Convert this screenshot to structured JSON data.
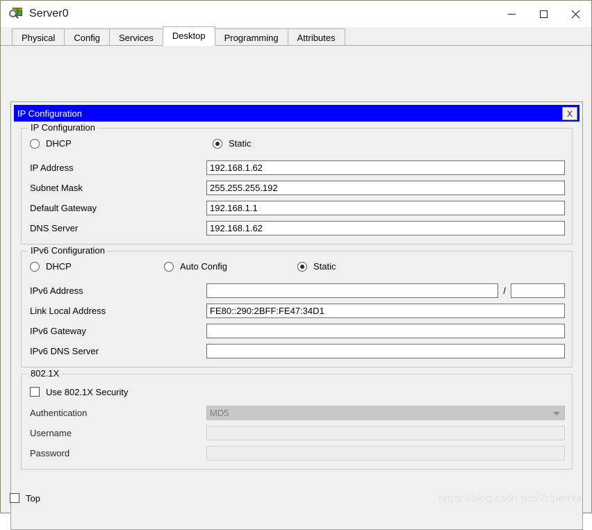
{
  "window": {
    "title": "Server0",
    "icon": "packet-tracer-icon",
    "minimize_label": "—",
    "maximize_label": "□",
    "close_label": "✕"
  },
  "tabs": [
    {
      "label": "Physical",
      "active": false
    },
    {
      "label": "Config",
      "active": false
    },
    {
      "label": "Services",
      "active": false
    },
    {
      "label": "Desktop",
      "active": true
    },
    {
      "label": "Programming",
      "active": false
    },
    {
      "label": "Attributes",
      "active": false
    }
  ],
  "inner_window": {
    "title": "IP Configuration",
    "close_label": "X",
    "titlebar_color": "#0000ff"
  },
  "ipv4": {
    "legend": "IP Configuration",
    "mode": {
      "dhcp_label": "DHCP",
      "dhcp_selected": false,
      "static_label": "Static",
      "static_selected": true
    },
    "fields": [
      {
        "label": "IP Address",
        "value": "192.168.1.62"
      },
      {
        "label": "Subnet Mask",
        "value": "255.255.255.192"
      },
      {
        "label": "Default Gateway",
        "value": "192.168.1.1"
      },
      {
        "label": "DNS Server",
        "value": "192.168.1.62"
      }
    ]
  },
  "ipv6": {
    "legend": "IPv6 Configuration",
    "mode": {
      "dhcp_label": "DHCP",
      "dhcp_selected": false,
      "auto_label": "Auto Config",
      "auto_selected": false,
      "static_label": "Static",
      "static_selected": true
    },
    "address_label": "IPv6 Address",
    "address_value": "",
    "prefix_separator": "/",
    "prefix_value": "",
    "fields": [
      {
        "label": "Link Local Address",
        "value": "FE80::290:2BFF:FE47:34D1"
      },
      {
        "label": "IPv6 Gateway",
        "value": ""
      },
      {
        "label": "IPv6 DNS Server",
        "value": ""
      }
    ]
  },
  "dot1x": {
    "legend": "802.1X",
    "use_security_label": "Use 802.1X Security",
    "use_security_checked": false,
    "authentication_label": "Authentication",
    "authentication_value": "MD5",
    "username_label": "Username",
    "username_value": "",
    "password_label": "Password",
    "password_value": ""
  },
  "bottom": {
    "top_checkbox_label": "Top",
    "top_checkbox_checked": false
  },
  "watermark": "https://blog.csdn.net/ZripenYe"
}
